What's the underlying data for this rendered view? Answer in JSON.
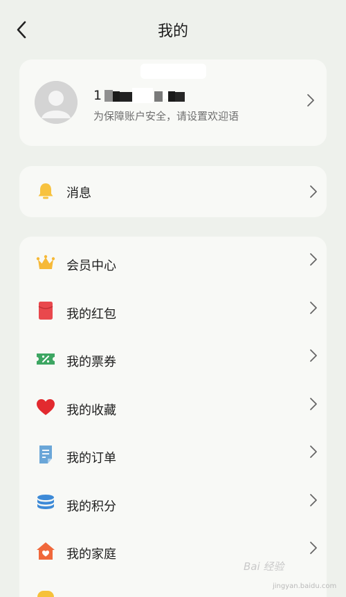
{
  "header": {
    "title": "我的",
    "back_icon": "chevron-left-icon"
  },
  "profile": {
    "name_visible": "1",
    "subtitle": "为保障账户安全，请设置欢迎语",
    "avatar_icon": "default-avatar-icon",
    "chevron_icon": "chevron-right-icon"
  },
  "message": {
    "label": "消息",
    "icon": "bell-icon",
    "icon_color": "#f7c23f"
  },
  "menu": {
    "items": [
      {
        "label": "会员中心",
        "icon": "crown-icon",
        "color": "#f6b938"
      },
      {
        "label": "我的红包",
        "icon": "red-packet-icon",
        "color": "#e9484d"
      },
      {
        "label": "我的票券",
        "icon": "ticket-icon",
        "color": "#3da662"
      },
      {
        "label": "我的收藏",
        "icon": "heart-icon",
        "color": "#e22a2f"
      },
      {
        "label": "我的订单",
        "icon": "order-document-icon",
        "color": "#6aa6d8"
      },
      {
        "label": "我的积分",
        "icon": "points-stack-icon",
        "color": "#3d8ad7"
      },
      {
        "label": "我的家庭",
        "icon": "home-icon",
        "color": "#f0683b"
      }
    ]
  },
  "watermark": {
    "text": "Bai 经验",
    "url": "jingyan.baidu.com"
  }
}
